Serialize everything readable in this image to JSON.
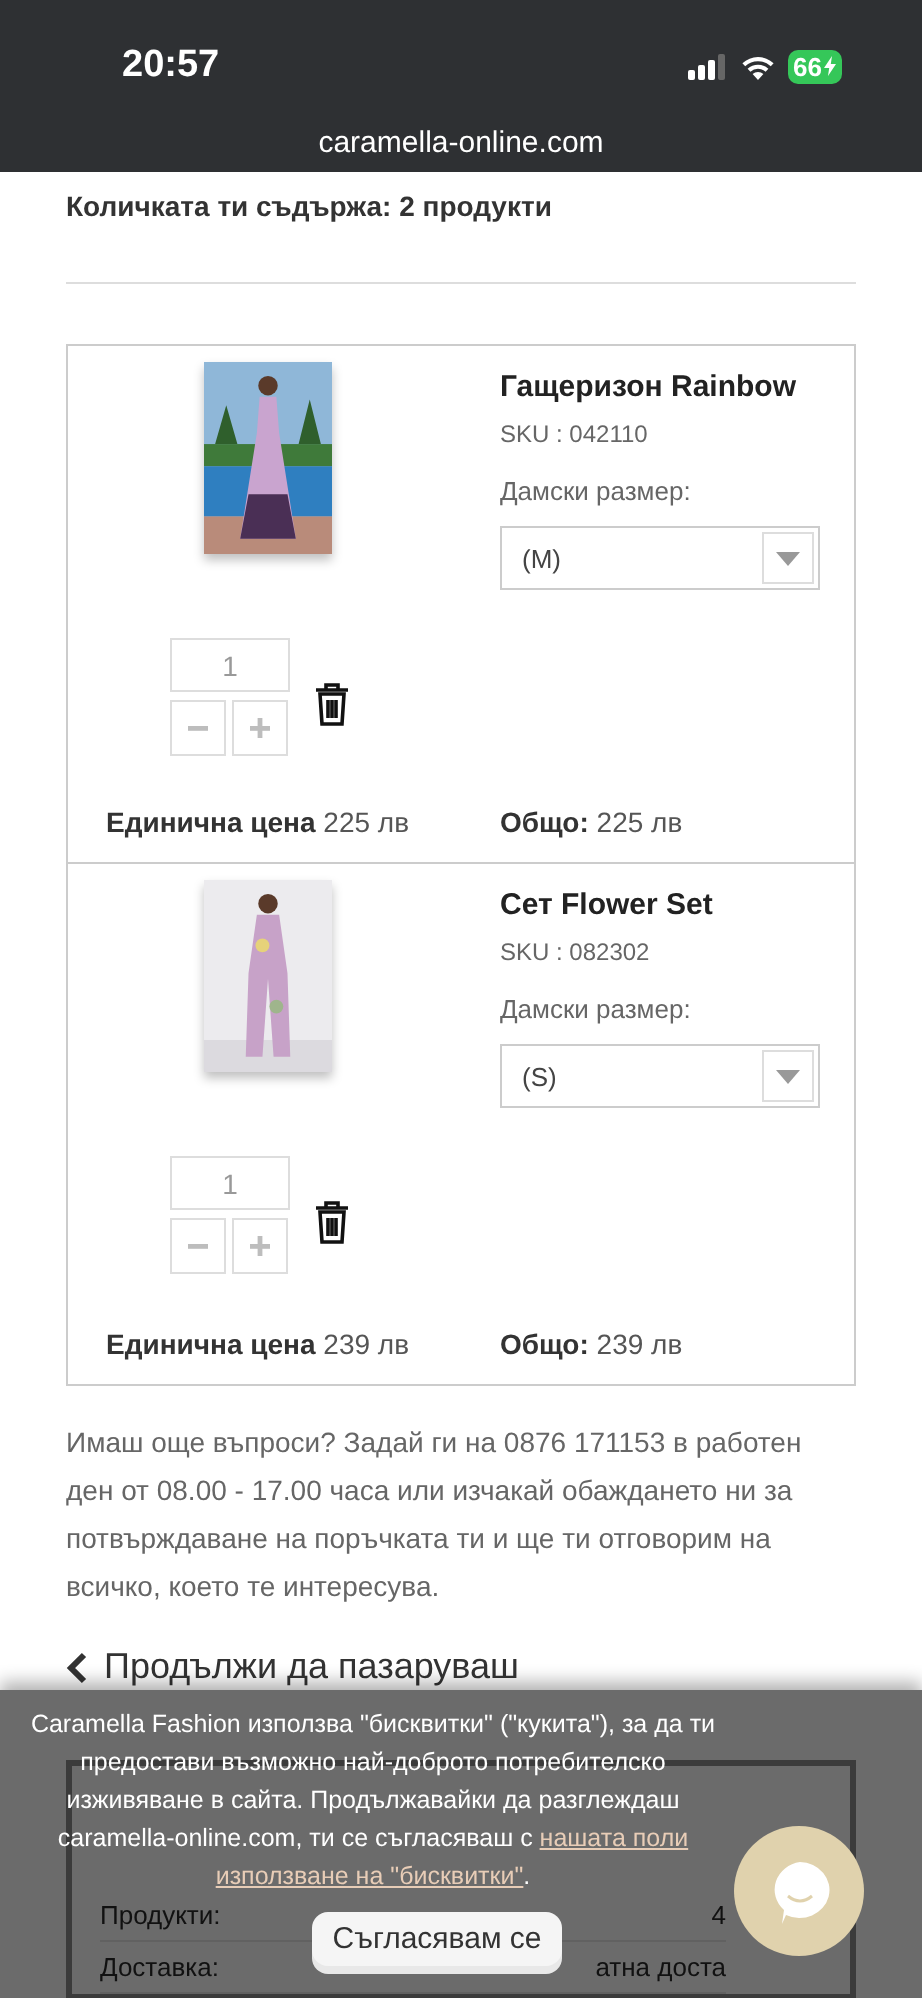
{
  "status_bar": {
    "time": "20:57",
    "battery": "66"
  },
  "address_bar": {
    "url": "caramella-online.com"
  },
  "cart_count": "Количката ти съдържа: 2 продукти",
  "items": [
    {
      "name": "Гащеризон Rainbow",
      "sku": "SKU : 042110",
      "size_label": "Дамски размер:",
      "size": "(M)",
      "quantity": "1",
      "unit_price_label": "Единична цена",
      "unit_price": "225 лв",
      "total_label": "Общо:",
      "total": "225 лв"
    },
    {
      "name": "Сет Flower Set",
      "sku": "SKU : 082302",
      "size_label": "Дамски размер:",
      "size": "(S)",
      "quantity": "1",
      "unit_price_label": "Единична цена",
      "unit_price": "239 лв",
      "total_label": "Общо:",
      "total": "239 лв"
    }
  ],
  "help_text": "Имаш още въпроси? Задай ги на 0876 171153 в работен ден от 08.00 - 17.00 часа или изчакай обаждането ни за потвърждаване на поръчката ти и ще ти отговорим на всичко, което те интересува.",
  "continue_link": "Продължи да пазаруваш",
  "summary": {
    "rows": [
      {
        "label": "Продукти:",
        "value": "4"
      },
      {
        "label": "Доставка:",
        "value": "атна доста"
      }
    ]
  },
  "cookie_banner": {
    "text": "Caramella Fashion използва \"бисквитки\" (\"кукита\"), за да ти предостави възможно най-доброто потребителско изживяване в сайта. Продължавайки да разглеждаш caramella-online.com, ти се съгласяваш с ",
    "link_start": "нашата поли",
    "link_end": "използване на \"бисквитки\"",
    "end": ".",
    "button": "Съгласявам се"
  }
}
